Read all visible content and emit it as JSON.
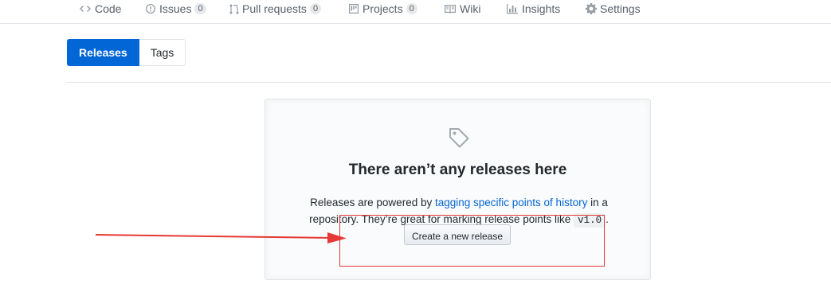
{
  "repo_nav": {
    "code": {
      "label": "Code",
      "icon": "code-icon"
    },
    "issues": {
      "label": "Issues",
      "count": "0",
      "icon": "issue-opened-icon"
    },
    "pull_requests": {
      "label": "Pull requests",
      "count": "0",
      "icon": "git-pull-request-icon"
    },
    "projects": {
      "label": "Projects",
      "count": "0",
      "icon": "project-icon"
    },
    "wiki": {
      "label": "Wiki",
      "icon": "book-icon"
    },
    "insights": {
      "label": "Insights",
      "icon": "graph-icon"
    },
    "settings": {
      "label": "Settings",
      "icon": "gear-icon"
    }
  },
  "subnav": {
    "releases": "Releases",
    "tags": "Tags"
  },
  "blankslate": {
    "icon": "tag-icon",
    "title": "There aren’t any releases here",
    "text_before_link": "Releases are powered by ",
    "link_text": "tagging specific points of history",
    "text_after_link": " in a repository. They’re great for marking release points like ",
    "code_example": "v1.0",
    "text_end": ".",
    "create_button": "Create a new release"
  },
  "annotation": {
    "color": "#e53935"
  }
}
